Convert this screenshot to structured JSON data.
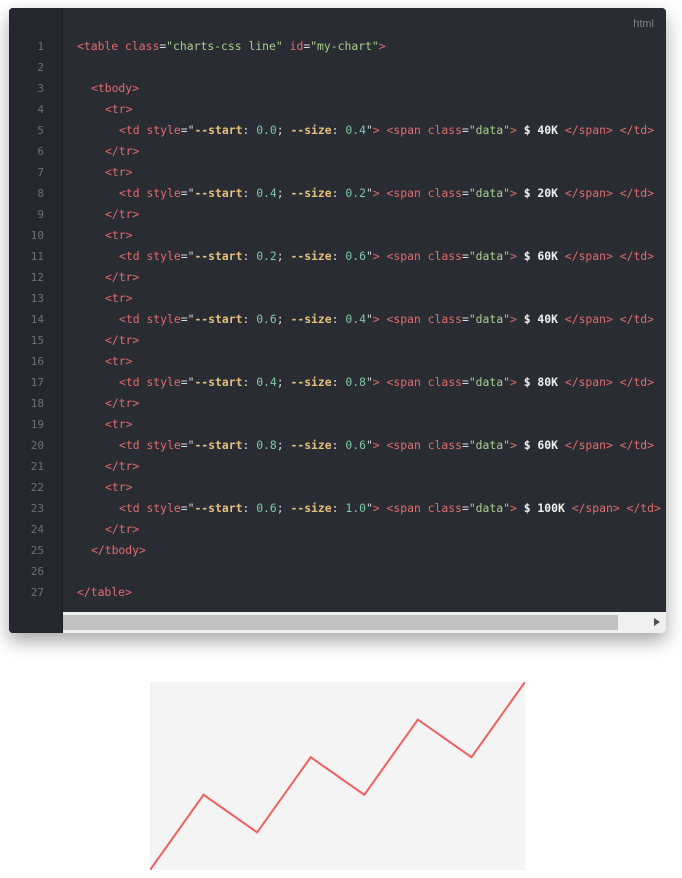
{
  "editor": {
    "language": "html",
    "line_numbers": [
      "1",
      "2",
      "3",
      "4",
      "5",
      "6",
      "7",
      "8",
      "9",
      "10",
      "11",
      "12",
      "13",
      "14",
      "15",
      "16",
      "17",
      "18",
      "19",
      "20",
      "21",
      "22",
      "23",
      "24",
      "25",
      "26",
      "27"
    ],
    "lines": [
      {
        "n": 1,
        "indent": 0,
        "tokens": [
          [
            "tag",
            "<table"
          ],
          [
            "punc",
            " "
          ],
          [
            "attr",
            "class"
          ],
          [
            "punc",
            "="
          ],
          [
            "str",
            "\"charts-css line\""
          ],
          [
            "punc",
            " "
          ],
          [
            "attr",
            "id"
          ],
          [
            "punc",
            "="
          ],
          [
            "str",
            "\"my-chart\""
          ],
          [
            "tag",
            ">"
          ]
        ]
      },
      {
        "n": 2,
        "indent": 0,
        "tokens": []
      },
      {
        "n": 3,
        "indent": 1,
        "tokens": [
          [
            "tag",
            "<tbody>"
          ]
        ]
      },
      {
        "n": 4,
        "indent": 2,
        "tokens": [
          [
            "tag",
            "<tr>"
          ]
        ]
      },
      {
        "n": 5,
        "indent": 3,
        "tokens": [
          [
            "tag",
            "<td"
          ],
          [
            "punc",
            " "
          ],
          [
            "attr",
            "style"
          ],
          [
            "punc",
            "=\""
          ],
          [
            "prop",
            "--start"
          ],
          [
            "punc",
            ": "
          ],
          [
            "num",
            "0.0"
          ],
          [
            "punc",
            "; "
          ],
          [
            "prop",
            "--size"
          ],
          [
            "punc",
            ": "
          ],
          [
            "num",
            "0.4"
          ],
          [
            "punc",
            "\""
          ],
          [
            "tag",
            ">"
          ],
          [
            "punc",
            " "
          ],
          [
            "tag",
            "<span"
          ],
          [
            "punc",
            " "
          ],
          [
            "attr",
            "class"
          ],
          [
            "punc",
            "="
          ],
          [
            "str",
            "\"data\""
          ],
          [
            "tag",
            ">"
          ],
          [
            "punc",
            " "
          ],
          [
            "txt",
            "$ 40K"
          ],
          [
            "punc",
            " "
          ],
          [
            "tag",
            "</span>"
          ],
          [
            "punc",
            " "
          ],
          [
            "tag",
            "</td>"
          ]
        ]
      },
      {
        "n": 6,
        "indent": 2,
        "tokens": [
          [
            "tag",
            "</tr>"
          ]
        ]
      },
      {
        "n": 7,
        "indent": 2,
        "tokens": [
          [
            "tag",
            "<tr>"
          ]
        ]
      },
      {
        "n": 8,
        "indent": 3,
        "tokens": [
          [
            "tag",
            "<td"
          ],
          [
            "punc",
            " "
          ],
          [
            "attr",
            "style"
          ],
          [
            "punc",
            "=\""
          ],
          [
            "prop",
            "--start"
          ],
          [
            "punc",
            ": "
          ],
          [
            "num",
            "0.4"
          ],
          [
            "punc",
            "; "
          ],
          [
            "prop",
            "--size"
          ],
          [
            "punc",
            ": "
          ],
          [
            "num",
            "0.2"
          ],
          [
            "punc",
            "\""
          ],
          [
            "tag",
            ">"
          ],
          [
            "punc",
            " "
          ],
          [
            "tag",
            "<span"
          ],
          [
            "punc",
            " "
          ],
          [
            "attr",
            "class"
          ],
          [
            "punc",
            "="
          ],
          [
            "str",
            "\"data\""
          ],
          [
            "tag",
            ">"
          ],
          [
            "punc",
            " "
          ],
          [
            "txt",
            "$ 20K"
          ],
          [
            "punc",
            " "
          ],
          [
            "tag",
            "</span>"
          ],
          [
            "punc",
            " "
          ],
          [
            "tag",
            "</td>"
          ]
        ]
      },
      {
        "n": 9,
        "indent": 2,
        "tokens": [
          [
            "tag",
            "</tr>"
          ]
        ]
      },
      {
        "n": 10,
        "indent": 2,
        "tokens": [
          [
            "tag",
            "<tr>"
          ]
        ]
      },
      {
        "n": 11,
        "indent": 3,
        "tokens": [
          [
            "tag",
            "<td"
          ],
          [
            "punc",
            " "
          ],
          [
            "attr",
            "style"
          ],
          [
            "punc",
            "=\""
          ],
          [
            "prop",
            "--start"
          ],
          [
            "punc",
            ": "
          ],
          [
            "num",
            "0.2"
          ],
          [
            "punc",
            "; "
          ],
          [
            "prop",
            "--size"
          ],
          [
            "punc",
            ": "
          ],
          [
            "num",
            "0.6"
          ],
          [
            "punc",
            "\""
          ],
          [
            "tag",
            ">"
          ],
          [
            "punc",
            " "
          ],
          [
            "tag",
            "<span"
          ],
          [
            "punc",
            " "
          ],
          [
            "attr",
            "class"
          ],
          [
            "punc",
            "="
          ],
          [
            "str",
            "\"data\""
          ],
          [
            "tag",
            ">"
          ],
          [
            "punc",
            " "
          ],
          [
            "txt",
            "$ 60K"
          ],
          [
            "punc",
            " "
          ],
          [
            "tag",
            "</span>"
          ],
          [
            "punc",
            " "
          ],
          [
            "tag",
            "</td>"
          ]
        ]
      },
      {
        "n": 12,
        "indent": 2,
        "tokens": [
          [
            "tag",
            "</tr>"
          ]
        ]
      },
      {
        "n": 13,
        "indent": 2,
        "tokens": [
          [
            "tag",
            "<tr>"
          ]
        ]
      },
      {
        "n": 14,
        "indent": 3,
        "tokens": [
          [
            "tag",
            "<td"
          ],
          [
            "punc",
            " "
          ],
          [
            "attr",
            "style"
          ],
          [
            "punc",
            "=\""
          ],
          [
            "prop",
            "--start"
          ],
          [
            "punc",
            ": "
          ],
          [
            "num",
            "0.6"
          ],
          [
            "punc",
            "; "
          ],
          [
            "prop",
            "--size"
          ],
          [
            "punc",
            ": "
          ],
          [
            "num",
            "0.4"
          ],
          [
            "punc",
            "\""
          ],
          [
            "tag",
            ">"
          ],
          [
            "punc",
            " "
          ],
          [
            "tag",
            "<span"
          ],
          [
            "punc",
            " "
          ],
          [
            "attr",
            "class"
          ],
          [
            "punc",
            "="
          ],
          [
            "str",
            "\"data\""
          ],
          [
            "tag",
            ">"
          ],
          [
            "punc",
            " "
          ],
          [
            "txt",
            "$ 40K"
          ],
          [
            "punc",
            " "
          ],
          [
            "tag",
            "</span>"
          ],
          [
            "punc",
            " "
          ],
          [
            "tag",
            "</td>"
          ]
        ]
      },
      {
        "n": 15,
        "indent": 2,
        "tokens": [
          [
            "tag",
            "</tr>"
          ]
        ]
      },
      {
        "n": 16,
        "indent": 2,
        "tokens": [
          [
            "tag",
            "<tr>"
          ]
        ]
      },
      {
        "n": 17,
        "indent": 3,
        "tokens": [
          [
            "tag",
            "<td"
          ],
          [
            "punc",
            " "
          ],
          [
            "attr",
            "style"
          ],
          [
            "punc",
            "=\""
          ],
          [
            "prop",
            "--start"
          ],
          [
            "punc",
            ": "
          ],
          [
            "num",
            "0.4"
          ],
          [
            "punc",
            "; "
          ],
          [
            "prop",
            "--size"
          ],
          [
            "punc",
            ": "
          ],
          [
            "num",
            "0.8"
          ],
          [
            "punc",
            "\""
          ],
          [
            "tag",
            ">"
          ],
          [
            "punc",
            " "
          ],
          [
            "tag",
            "<span"
          ],
          [
            "punc",
            " "
          ],
          [
            "attr",
            "class"
          ],
          [
            "punc",
            "="
          ],
          [
            "str",
            "\"data\""
          ],
          [
            "tag",
            ">"
          ],
          [
            "punc",
            " "
          ],
          [
            "txt",
            "$ 80K"
          ],
          [
            "punc",
            " "
          ],
          [
            "tag",
            "</span>"
          ],
          [
            "punc",
            " "
          ],
          [
            "tag",
            "</td>"
          ]
        ]
      },
      {
        "n": 18,
        "indent": 2,
        "tokens": [
          [
            "tag",
            "</tr>"
          ]
        ]
      },
      {
        "n": 19,
        "indent": 2,
        "tokens": [
          [
            "tag",
            "<tr>"
          ]
        ]
      },
      {
        "n": 20,
        "indent": 3,
        "tokens": [
          [
            "tag",
            "<td"
          ],
          [
            "punc",
            " "
          ],
          [
            "attr",
            "style"
          ],
          [
            "punc",
            "=\""
          ],
          [
            "prop",
            "--start"
          ],
          [
            "punc",
            ": "
          ],
          [
            "num",
            "0.8"
          ],
          [
            "punc",
            "; "
          ],
          [
            "prop",
            "--size"
          ],
          [
            "punc",
            ": "
          ],
          [
            "num",
            "0.6"
          ],
          [
            "punc",
            "\""
          ],
          [
            "tag",
            ">"
          ],
          [
            "punc",
            " "
          ],
          [
            "tag",
            "<span"
          ],
          [
            "punc",
            " "
          ],
          [
            "attr",
            "class"
          ],
          [
            "punc",
            "="
          ],
          [
            "str",
            "\"data\""
          ],
          [
            "tag",
            ">"
          ],
          [
            "punc",
            " "
          ],
          [
            "txt",
            "$ 60K"
          ],
          [
            "punc",
            " "
          ],
          [
            "tag",
            "</span>"
          ],
          [
            "punc",
            " "
          ],
          [
            "tag",
            "</td>"
          ]
        ]
      },
      {
        "n": 21,
        "indent": 2,
        "tokens": [
          [
            "tag",
            "</tr>"
          ]
        ]
      },
      {
        "n": 22,
        "indent": 2,
        "tokens": [
          [
            "tag",
            "<tr>"
          ]
        ]
      },
      {
        "n": 23,
        "indent": 3,
        "tokens": [
          [
            "tag",
            "<td"
          ],
          [
            "punc",
            " "
          ],
          [
            "attr",
            "style"
          ],
          [
            "punc",
            "=\""
          ],
          [
            "prop",
            "--start"
          ],
          [
            "punc",
            ": "
          ],
          [
            "num",
            "0.6"
          ],
          [
            "punc",
            "; "
          ],
          [
            "prop",
            "--size"
          ],
          [
            "punc",
            ": "
          ],
          [
            "num",
            "1.0"
          ],
          [
            "punc",
            "\""
          ],
          [
            "tag",
            ">"
          ],
          [
            "punc",
            " "
          ],
          [
            "tag",
            "<span"
          ],
          [
            "punc",
            " "
          ],
          [
            "attr",
            "class"
          ],
          [
            "punc",
            "="
          ],
          [
            "str",
            "\"data\""
          ],
          [
            "tag",
            ">"
          ],
          [
            "punc",
            " "
          ],
          [
            "txt",
            "$ 100K"
          ],
          [
            "punc",
            " "
          ],
          [
            "tag",
            "</span>"
          ],
          [
            "punc",
            " "
          ],
          [
            "tag",
            "</td>"
          ]
        ]
      },
      {
        "n": 24,
        "indent": 2,
        "tokens": [
          [
            "tag",
            "</tr>"
          ]
        ]
      },
      {
        "n": 25,
        "indent": 1,
        "tokens": [
          [
            "tag",
            "</tbody>"
          ]
        ]
      },
      {
        "n": 26,
        "indent": 0,
        "tokens": []
      },
      {
        "n": 27,
        "indent": 0,
        "tokens": [
          [
            "tag",
            "</table>"
          ]
        ]
      }
    ]
  },
  "colors": {
    "editor_bg": "#292c33",
    "gutter_bg": "#24272d",
    "tag": "#e06c6c",
    "string": "#a6d189",
    "property": "#e5c07b",
    "number": "#7ec9a6",
    "chart_line": "#f06060",
    "chart_bg": "#f4f4f4"
  },
  "chart_data": {
    "type": "line",
    "starts": [
      0.0,
      0.4,
      0.2,
      0.6,
      0.4,
      0.8,
      0.6
    ],
    "values": [
      0.4,
      0.2,
      0.6,
      0.4,
      0.8,
      0.6,
      1.0
    ],
    "labels": [
      "$ 40K",
      "$ 20K",
      "$ 60K",
      "$ 40K",
      "$ 80K",
      "$ 60K",
      "$ 100K"
    ],
    "ylim": [
      0,
      1
    ],
    "grid": false,
    "legend": "none"
  }
}
